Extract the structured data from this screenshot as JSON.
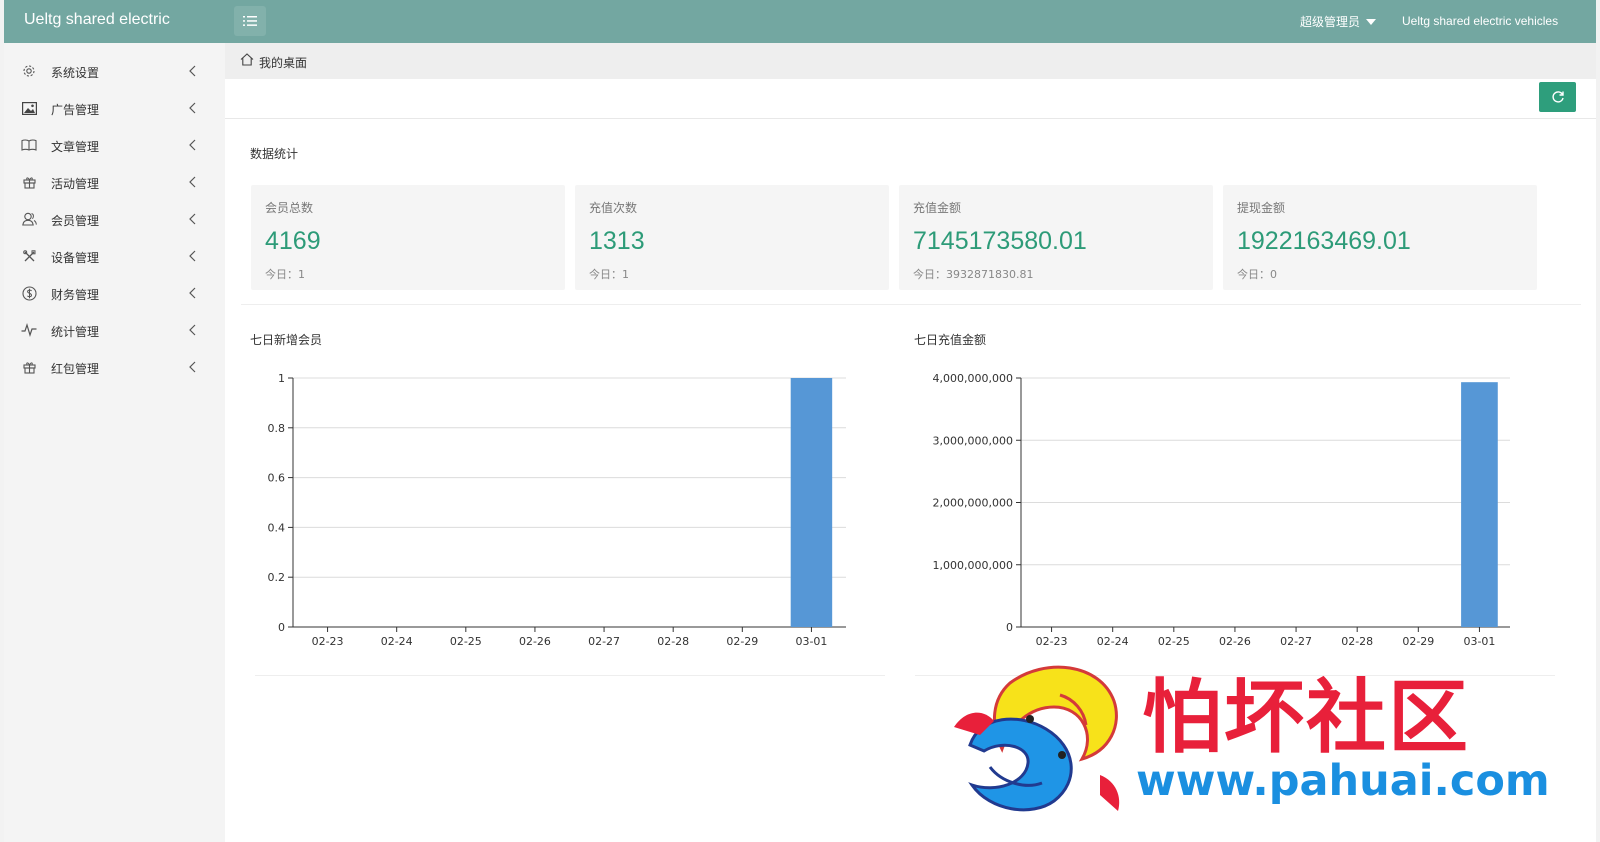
{
  "header": {
    "logo": "Ueltg shared electric",
    "user": "超级管理员",
    "site": "Ueltg shared electric vehicles"
  },
  "icons": {
    "menu": "list-icon",
    "home": "home-icon",
    "refresh": "refresh-icon",
    "chevron": "chevron-left-icon"
  },
  "colors": {
    "header": "#73a7a1",
    "accent": "#2d9b78",
    "bar": "#5697d6",
    "watermark_red": "#e8203a",
    "watermark_blue": "#1a8fe0"
  },
  "sidebar": {
    "items": [
      {
        "label": "系统设置",
        "icon": "gear-icon"
      },
      {
        "label": "广告管理",
        "icon": "image-icon"
      },
      {
        "label": "文章管理",
        "icon": "book-icon"
      },
      {
        "label": "活动管理",
        "icon": "gift-icon"
      },
      {
        "label": "会员管理",
        "icon": "users-icon"
      },
      {
        "label": "设备管理",
        "icon": "tools-icon"
      },
      {
        "label": "财务管理",
        "icon": "dollar-icon"
      },
      {
        "label": "统计管理",
        "icon": "pulse-icon"
      },
      {
        "label": "红包管理",
        "icon": "gift-icon"
      }
    ]
  },
  "breadcrumb": {
    "current": "我的桌面"
  },
  "stats_section": {
    "title": "数据统计"
  },
  "stats": [
    {
      "label": "会员总数",
      "value": "4169",
      "today": "今日：1"
    },
    {
      "label": "充值次数",
      "value": "1313",
      "today": "今日：1"
    },
    {
      "label": "充值金额",
      "value": "7145173580.01",
      "today": "今日：3932871830.81"
    },
    {
      "label": "提现金额",
      "value": "1922163469.01",
      "today": "今日：0"
    }
  ],
  "chart_titles": [
    "七日新增会员",
    "七日充值金额"
  ],
  "chart_data": [
    {
      "type": "bar",
      "title": "七日新增会员",
      "categories": [
        "02-23",
        "02-24",
        "02-25",
        "02-26",
        "02-27",
        "02-28",
        "02-29",
        "03-01"
      ],
      "values": [
        0,
        0,
        0,
        0,
        0,
        0,
        0,
        1
      ],
      "ylim": [
        0,
        1
      ],
      "yticks": [
        "0",
        "0.2",
        "0.4",
        "0.6",
        "0.8",
        "1"
      ],
      "grid": true
    },
    {
      "type": "bar",
      "title": "七日充值金额",
      "categories": [
        "02-23",
        "02-24",
        "02-25",
        "02-26",
        "02-27",
        "02-28",
        "02-29",
        "03-01"
      ],
      "values": [
        0,
        0,
        0,
        0,
        0,
        0,
        0,
        3932871830.81
      ],
      "ylim": [
        0,
        4000000000
      ],
      "yticks": [
        "0",
        "1,000,000,000",
        "2,000,000,000",
        "3,000,000,000",
        "4,000,000,000"
      ],
      "grid": true
    }
  ],
  "watermark": {
    "title": "怕坏社区",
    "url": "www.pahuai.com"
  }
}
